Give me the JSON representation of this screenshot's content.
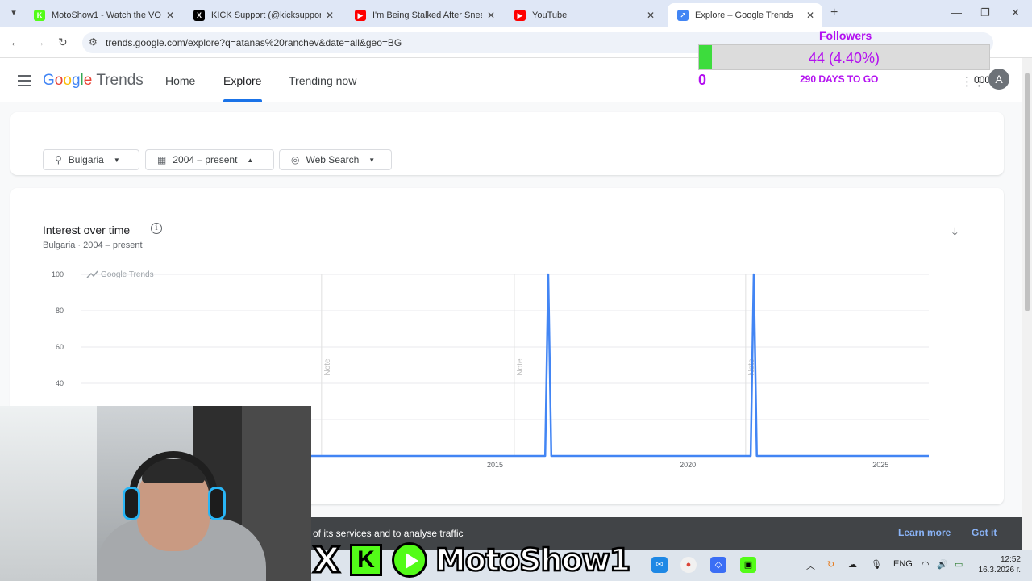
{
  "browser": {
    "tabs": [
      {
        "title": "MotoShow1 - Watch the VOD o",
        "favicon_color": "#53fc18",
        "favicon_letter": "K"
      },
      {
        "title": "KICK Support (@kicksupport) /",
        "favicon_color": "#000000",
        "favicon_letter": "X"
      },
      {
        "title": "I'm Being Stalked After Sneakin",
        "favicon_color": "#ff0000",
        "favicon_letter": "▶"
      },
      {
        "title": "YouTube",
        "favicon_color": "#ff0000",
        "favicon_letter": "▶"
      },
      {
        "title": "Explore – Google Trends",
        "favicon_color": "#4285f4",
        "favicon_letter": "↗",
        "active": true
      }
    ],
    "url": "trends.google.com/explore?q=atanas%20ranchev&date=all&geo=BG"
  },
  "followers_overlay": {
    "label": "Followers",
    "progress_text": "44 (4.40%)",
    "progress": 0.044,
    "start_value": "0",
    "days_text": "290 DAYS TO GO"
  },
  "header": {
    "logo_google": [
      "G",
      "o",
      "o",
      "g",
      "l",
      "e"
    ],
    "logo_trends": "Trends",
    "nav": [
      "Home",
      "Explore",
      "Trending now"
    ],
    "apps_extra": "000",
    "avatar_letter": "A"
  },
  "filters": {
    "region": "Bulgaria",
    "time": "2004 – present",
    "source": "Web Search"
  },
  "chart": {
    "title": "Interest over time",
    "subtitle": "Bulgaria · 2004 – present",
    "watermark": "Google Trends",
    "note_label": "Note"
  },
  "chart_data": {
    "type": "line",
    "title": "Interest over time",
    "xlabel": "",
    "ylabel": "",
    "ylim": [
      0,
      100
    ],
    "xlim": [
      2004.0,
      2026.25
    ],
    "y_ticks": [
      "100",
      "80",
      "60",
      "40"
    ],
    "x_ticks": [
      2015,
      2020,
      2025
    ],
    "notes_at": [
      2010.5,
      2015.5,
      2021.5
    ],
    "series": [
      {
        "color": "#4285f4",
        "points": [
          [
            2004.0,
            0
          ],
          [
            2016.3,
            0
          ],
          [
            2016.38,
            100
          ],
          [
            2016.46,
            0
          ],
          [
            2021.63,
            0
          ],
          [
            2021.71,
            100
          ],
          [
            2021.79,
            0
          ],
          [
            2026.25,
            0
          ]
        ]
      }
    ]
  },
  "cookie_banner": {
    "text": "of its services and to analyse traffic",
    "learn_more": "Learn more",
    "got_it": "Got it"
  },
  "taskbar": {
    "lang": "ENG",
    "time": "12:52",
    "date": "16.3.2026 г."
  },
  "stream_brand": {
    "name": "MotoShow1"
  }
}
